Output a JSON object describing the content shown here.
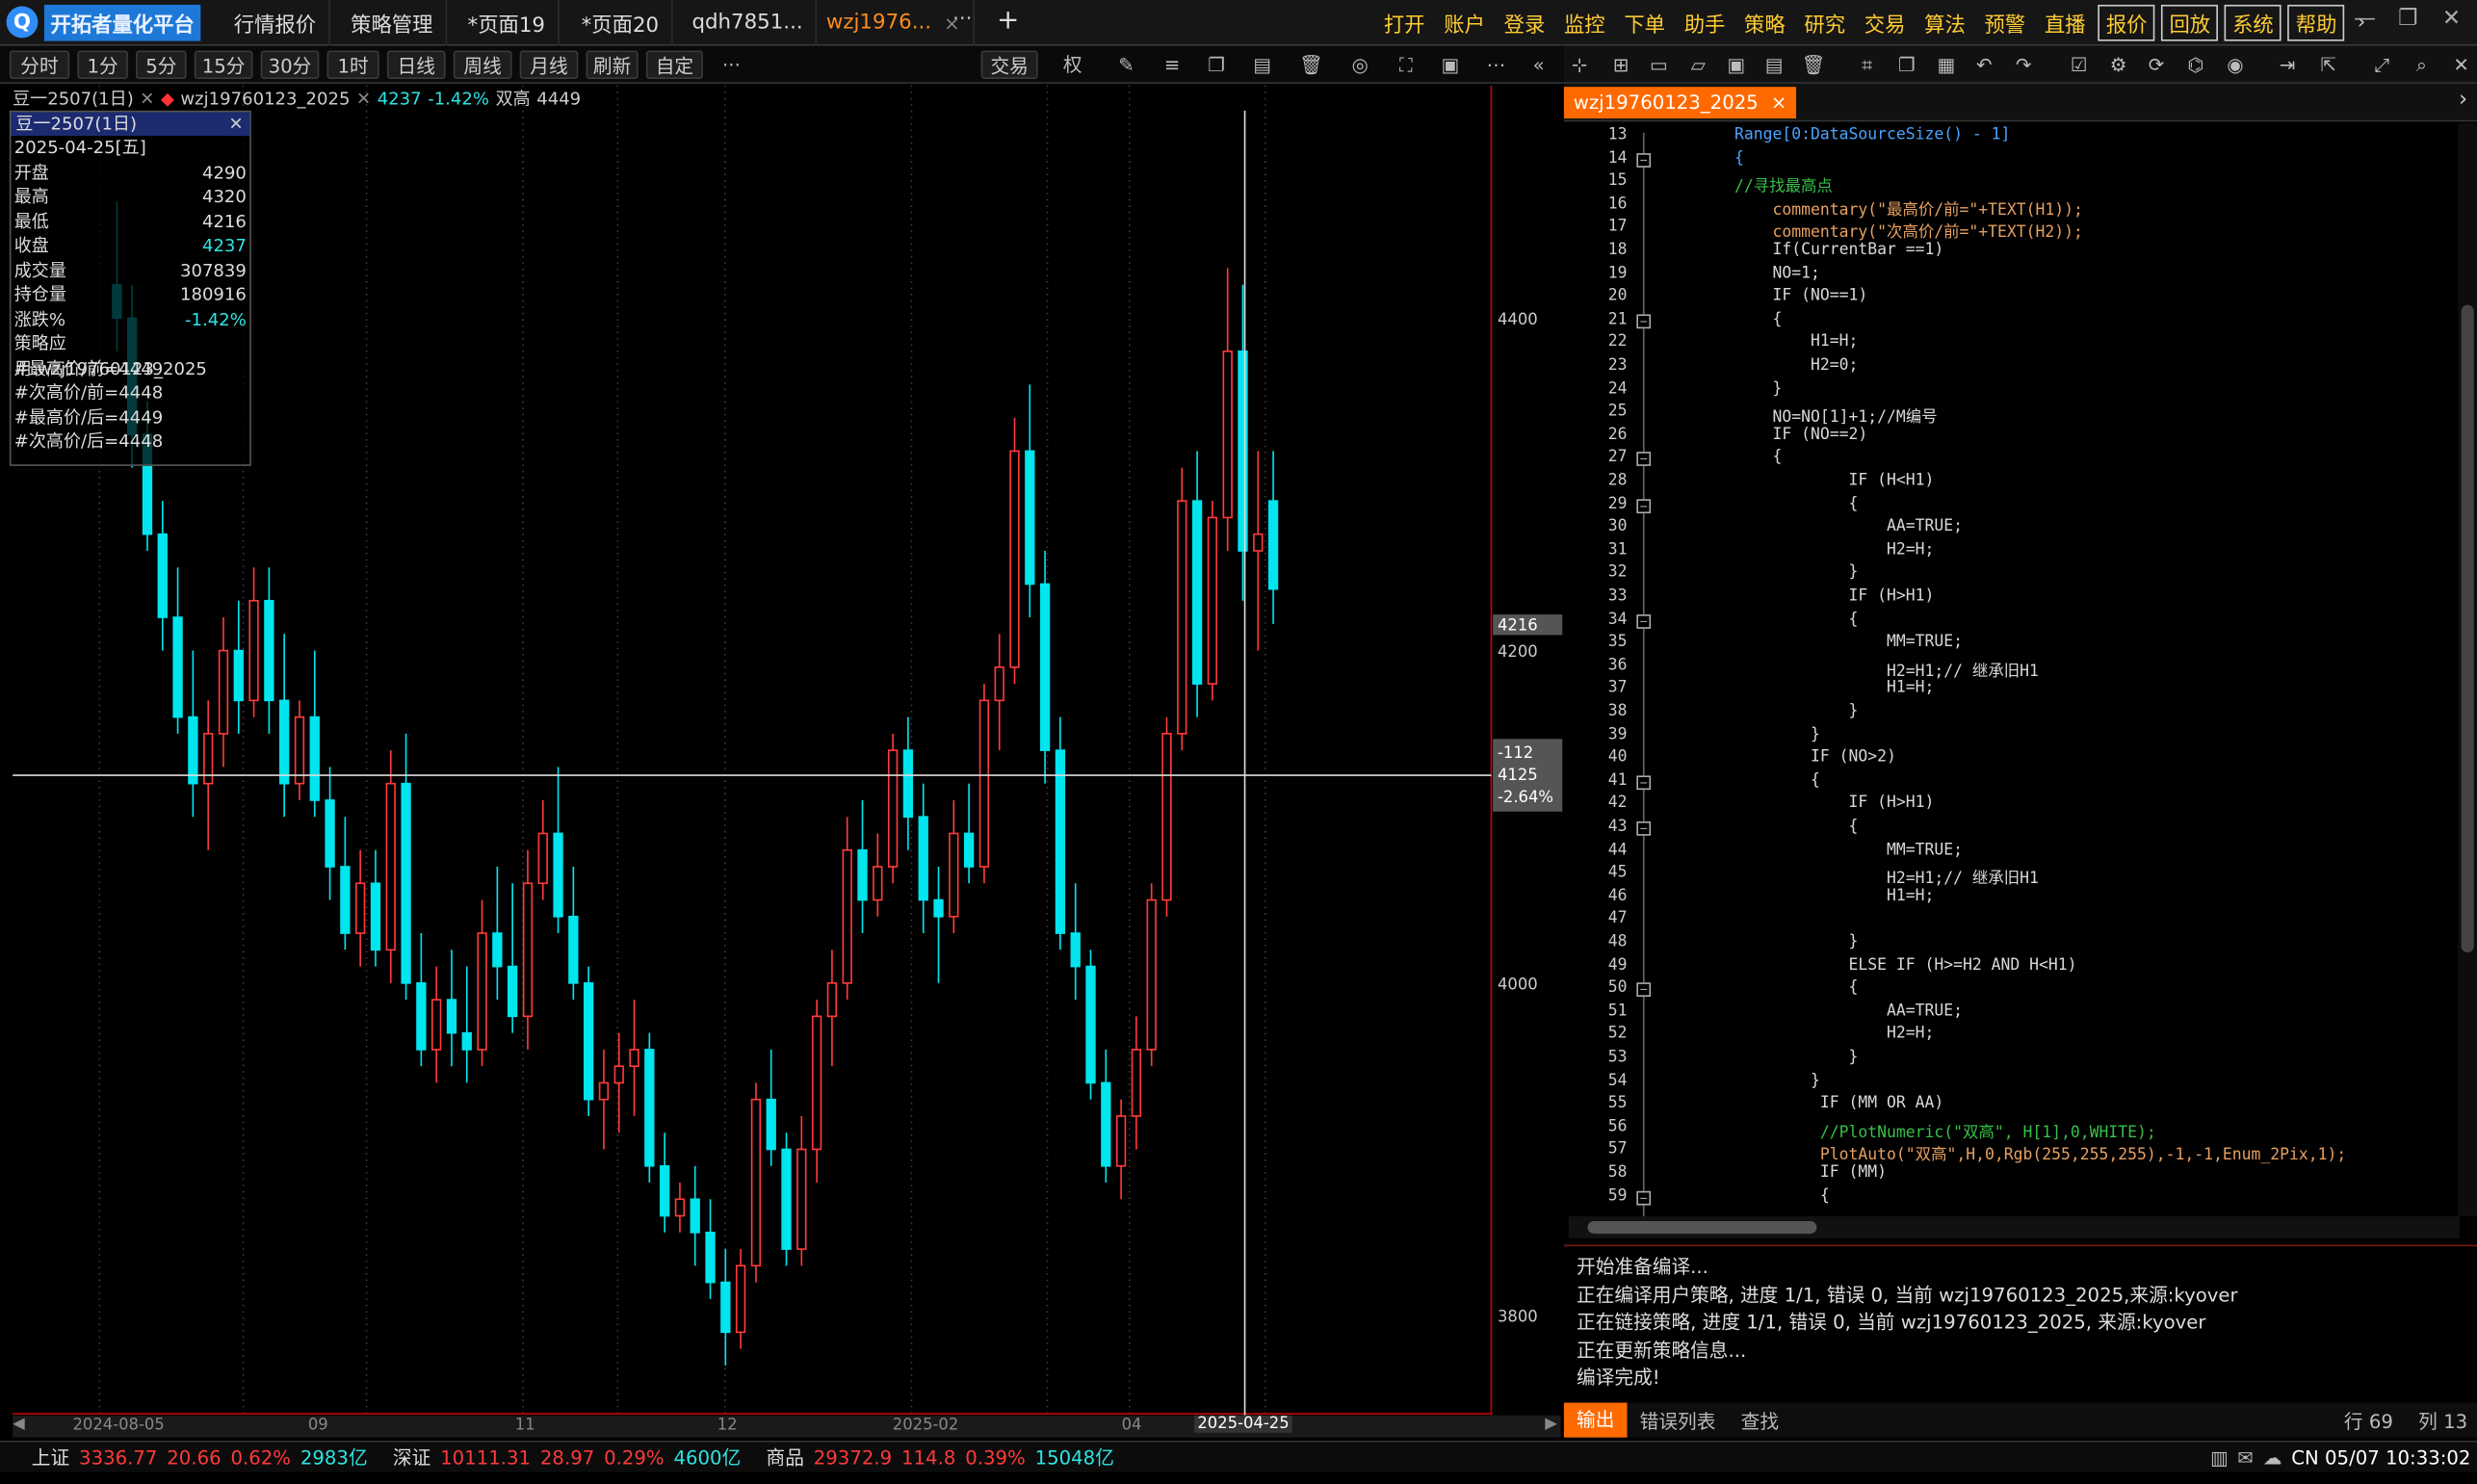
{
  "app": {
    "name": "开拓者量化平台"
  },
  "tabs": [
    {
      "label": "行情报价"
    },
    {
      "label": "策略管理"
    },
    {
      "label": "*页面19"
    },
    {
      "label": "*页面20"
    },
    {
      "label": "qdh7851..."
    },
    {
      "label": "wzj1976...",
      "close": "×"
    }
  ],
  "tab_more": "···",
  "tab_add": "+",
  "menu": [
    "打开",
    "账户",
    "登录",
    "监控",
    "下单",
    "助手",
    "策略",
    "研究",
    "交易",
    "算法",
    "预警",
    "直播"
  ],
  "menu_boxed": [
    "报价",
    "回放",
    "系统",
    "帮助"
  ],
  "periods": [
    "分时",
    "1分",
    "5分",
    "15分",
    "30分",
    "1时",
    "日线",
    "周线",
    "月线",
    "刷新",
    "自定"
  ],
  "period_more": "···",
  "trade_btn": "交易",
  "chart_tools": {
    "quan": "权"
  },
  "chart_info": {
    "symbol": "豆一2507(1日)",
    "strategy": "wzj19760123_2025",
    "price": "4237",
    "pct": "-1.42%",
    "label": "双高",
    "label_val": "4449"
  },
  "info_panel": {
    "title": "豆一2507(1日)",
    "date": "2025-04-25[五]",
    "rows": [
      [
        "开盘",
        "4290"
      ],
      [
        "最高",
        "4320"
      ],
      [
        "最低",
        "4216"
      ],
      [
        "收盘",
        "4237"
      ],
      [
        "成交量",
        "307839"
      ],
      [
        "持仓量",
        "180916"
      ],
      [
        "涨跌%",
        "-1.42%"
      ]
    ],
    "notes": [
      "策略应用:wzj19760123_2025",
      "#最高价/前=4449",
      "#次高价/前=4448",
      "#最高价/后=4449",
      "#次高价/后=4448"
    ]
  },
  "price_axis": {
    "ticks": [
      "4400",
      "4200",
      "4000",
      "3800"
    ],
    "last_price": "4216",
    "cross_diff": "-112",
    "cross_price": "4125",
    "cross_pct": "-2.64%"
  },
  "x_axis": {
    "labels": [
      "2024-08-05",
      "09",
      "11",
      "12",
      "2025-02",
      "04",
      "2025-04-25"
    ]
  },
  "status": {
    "items": [
      {
        "name": "上证",
        "val": "3336.77",
        "chg": "20.66",
        "pct": "0.62%",
        "amt": "2983亿"
      },
      {
        "name": "深证",
        "val": "10111.31",
        "chg": "28.97",
        "pct": "0.29%",
        "amt": "4600亿"
      },
      {
        "name": "商品",
        "val": "29372.9",
        "chg": "114.8",
        "pct": "0.39%",
        "amt": "15048亿"
      }
    ],
    "clock": "CN 05/07 10:33:02"
  },
  "editor": {
    "tab": "wzj19760123_2025",
    "close": "×",
    "cursor_row": "行 69",
    "cursor_col": "列 13",
    "lines": [
      {
        "n": "13",
        "t": "Range[0:DataSourceSize() - 1]",
        "i": 10,
        "c": "k"
      },
      {
        "n": "14",
        "t": "{",
        "i": 10,
        "c": "k"
      },
      {
        "n": "15",
        "t": "//寻找最高点",
        "i": 10,
        "c": "cm"
      },
      {
        "n": "16",
        "t": "commentary(\"最高价/前=\"+TEXT(H1));",
        "i": 14,
        "c": "s"
      },
      {
        "n": "17",
        "t": "commentary(\"次高价/前=\"+TEXT(H2));",
        "i": 14,
        "c": "s"
      },
      {
        "n": "18",
        "t": "If(CurrentBar ==1)",
        "i": 14,
        "c": "f"
      },
      {
        "n": "19",
        "t": "NO=1;",
        "i": 14,
        "c": "f"
      },
      {
        "n": "20",
        "t": "IF (NO==1)",
        "i": 14,
        "c": "f"
      },
      {
        "n": "21",
        "t": "{",
        "i": 14,
        "c": "f"
      },
      {
        "n": "22",
        "t": "H1=H;",
        "i": 18,
        "c": "f"
      },
      {
        "n": "23",
        "t": "H2=0;",
        "i": 18,
        "c": "f"
      },
      {
        "n": "24",
        "t": "}",
        "i": 14,
        "c": "f"
      },
      {
        "n": "25",
        "t": "NO=NO[1]+1;//M编号",
        "i": 14,
        "c": "f"
      },
      {
        "n": "26",
        "t": "IF (NO==2)",
        "i": 14,
        "c": "f"
      },
      {
        "n": "27",
        "t": "{",
        "i": 14,
        "c": "f"
      },
      {
        "n": "28",
        "t": "IF (H<H1)",
        "i": 22,
        "c": "f"
      },
      {
        "n": "29",
        "t": "{",
        "i": 22,
        "c": "f"
      },
      {
        "n": "30",
        "t": "AA=TRUE;",
        "i": 26,
        "c": "f"
      },
      {
        "n": "31",
        "t": "H2=H;",
        "i": 26,
        "c": "f"
      },
      {
        "n": "32",
        "t": "}",
        "i": 22,
        "c": "f"
      },
      {
        "n": "33",
        "t": "IF (H>H1)",
        "i": 22,
        "c": "f"
      },
      {
        "n": "34",
        "t": "{",
        "i": 22,
        "c": "f"
      },
      {
        "n": "35",
        "t": "MM=TRUE;",
        "i": 26,
        "c": "f"
      },
      {
        "n": "36",
        "t": "H2=H1;// 继承旧H1",
        "i": 26,
        "c": "f"
      },
      {
        "n": "37",
        "t": "H1=H;",
        "i": 26,
        "c": "f"
      },
      {
        "n": "38",
        "t": "}",
        "i": 22,
        "c": "f"
      },
      {
        "n": "39",
        "t": "}",
        "i": 18,
        "c": "f"
      },
      {
        "n": "40",
        "t": "IF (NO>2)",
        "i": 18,
        "c": "f"
      },
      {
        "n": "41",
        "t": "{",
        "i": 18,
        "c": "f"
      },
      {
        "n": "42",
        "t": "IF (H>H1)",
        "i": 22,
        "c": "f"
      },
      {
        "n": "43",
        "t": "{",
        "i": 22,
        "c": "f"
      },
      {
        "n": "44",
        "t": "MM=TRUE;",
        "i": 26,
        "c": "f"
      },
      {
        "n": "45",
        "t": "H2=H1;// 继承旧H1",
        "i": 26,
        "c": "f"
      },
      {
        "n": "46",
        "t": "H1=H;",
        "i": 26,
        "c": "f"
      },
      {
        "n": "47",
        "t": "",
        "i": 26,
        "c": "f"
      },
      {
        "n": "48",
        "t": "}",
        "i": 22,
        "c": "f"
      },
      {
        "n": "49",
        "t": "ELSE IF (H>=H2 AND H<H1)",
        "i": 22,
        "c": "f"
      },
      {
        "n": "50",
        "t": "{",
        "i": 22,
        "c": "f"
      },
      {
        "n": "51",
        "t": "AA=TRUE;",
        "i": 26,
        "c": "f"
      },
      {
        "n": "52",
        "t": "H2=H;",
        "i": 26,
        "c": "f"
      },
      {
        "n": "53",
        "t": "}",
        "i": 22,
        "c": "f"
      },
      {
        "n": "54",
        "t": "}",
        "i": 18,
        "c": "f"
      },
      {
        "n": "55",
        "t": "IF (MM OR AA)",
        "i": 19,
        "c": "f"
      },
      {
        "n": "56",
        "t": "//PlotNumeric(\"双高\", H[1],0,WHITE);",
        "i": 19,
        "c": "cm"
      },
      {
        "n": "57",
        "t": "PlotAuto(\"双高\",H,0,Rgb(255,255,255),-1,-1,Enum_2Pix,1);",
        "i": 19,
        "c": "s"
      },
      {
        "n": "58",
        "t": "IF (MM)",
        "i": 19,
        "c": "f"
      },
      {
        "n": "59",
        "t": "{",
        "i": 19,
        "c": "f"
      }
    ]
  },
  "output": {
    "lines": [
      "开始准备编译...",
      "正在编译用户策略, 进度 1/1, 错误 0, 当前 wzj19760123_2025,来源:kyover",
      "正在链接策略, 进度 1/1, 错误 0, 当前 wzj19760123_2025, 来源:kyover",
      "正在更新策略信息...",
      "编译完成!"
    ],
    "tabs": [
      "输出",
      "错误列表",
      "查找"
    ]
  },
  "chart_data": {
    "type": "candlestick",
    "y_range": [
      3740,
      4540
    ],
    "ticks": [
      4400,
      4200,
      4000,
      3800
    ],
    "crosshair_price": 4125,
    "colors": {
      "up": "#ff3a3a",
      "down": "#00e5ee",
      "grid": "#555",
      "axis": "#d00"
    },
    "candles": [
      [
        4420,
        4470,
        4380,
        4400
      ],
      [
        4400,
        4420,
        4310,
        4330
      ],
      [
        4330,
        4350,
        4260,
        4270
      ],
      [
        4270,
        4290,
        4200,
        4220
      ],
      [
        4220,
        4250,
        4150,
        4160
      ],
      [
        4160,
        4200,
        4100,
        4120
      ],
      [
        4120,
        4170,
        4080,
        4150
      ],
      [
        4150,
        4220,
        4130,
        4200
      ],
      [
        4200,
        4230,
        4150,
        4170
      ],
      [
        4170,
        4250,
        4160,
        4230
      ],
      [
        4230,
        4250,
        4150,
        4170
      ],
      [
        4170,
        4210,
        4100,
        4120
      ],
      [
        4120,
        4170,
        4110,
        4160
      ],
      [
        4160,
        4200,
        4100,
        4110
      ],
      [
        4110,
        4130,
        4050,
        4070
      ],
      [
        4070,
        4100,
        4020,
        4030
      ],
      [
        4030,
        4080,
        4010,
        4060
      ],
      [
        4060,
        4080,
        4010,
        4020
      ],
      [
        4020,
        4140,
        4000,
        4120
      ],
      [
        4120,
        4150,
        3990,
        4000
      ],
      [
        4000,
        4030,
        3950,
        3960
      ],
      [
        3960,
        4010,
        3940,
        3990
      ],
      [
        3990,
        4020,
        3950,
        3970
      ],
      [
        3970,
        4010,
        3940,
        3960
      ],
      [
        3960,
        4050,
        3950,
        4030
      ],
      [
        4030,
        4070,
        3990,
        4010
      ],
      [
        4010,
        4060,
        3970,
        3980
      ],
      [
        3980,
        4080,
        3960,
        4060
      ],
      [
        4060,
        4110,
        4050,
        4090
      ],
      [
        4090,
        4130,
        4030,
        4040
      ],
      [
        4040,
        4070,
        3990,
        4000
      ],
      [
        4000,
        4010,
        3920,
        3930
      ],
      [
        3930,
        3960,
        3900,
        3940
      ],
      [
        3940,
        3970,
        3910,
        3950
      ],
      [
        3950,
        3990,
        3920,
        3960
      ],
      [
        3960,
        3970,
        3880,
        3890
      ],
      [
        3890,
        3910,
        3850,
        3860
      ],
      [
        3860,
        3880,
        3850,
        3870
      ],
      [
        3870,
        3890,
        3830,
        3850
      ],
      [
        3850,
        3870,
        3810,
        3820
      ],
      [
        3820,
        3840,
        3770,
        3790
      ],
      [
        3790,
        3840,
        3780,
        3830
      ],
      [
        3830,
        3940,
        3820,
        3930
      ],
      [
        3930,
        3960,
        3890,
        3900
      ],
      [
        3900,
        3910,
        3830,
        3840
      ],
      [
        3840,
        3920,
        3830,
        3900
      ],
      [
        3900,
        3990,
        3880,
        3980
      ],
      [
        3980,
        4020,
        3950,
        4000
      ],
      [
        4000,
        4100,
        3990,
        4080
      ],
      [
        4080,
        4110,
        4030,
        4050
      ],
      [
        4050,
        4090,
        4040,
        4070
      ],
      [
        4070,
        4150,
        4060,
        4140
      ],
      [
        4140,
        4160,
        4080,
        4100
      ],
      [
        4100,
        4120,
        4030,
        4050
      ],
      [
        4050,
        4070,
        4000,
        4040
      ],
      [
        4040,
        4110,
        4030,
        4090
      ],
      [
        4090,
        4120,
        4060,
        4070
      ],
      [
        4070,
        4180,
        4060,
        4170
      ],
      [
        4170,
        4210,
        4140,
        4190
      ],
      [
        4190,
        4340,
        4180,
        4320
      ],
      [
        4320,
        4360,
        4220,
        4240
      ],
      [
        4240,
        4260,
        4120,
        4140
      ],
      [
        4140,
        4160,
        4020,
        4030
      ],
      [
        4030,
        4060,
        3990,
        4010
      ],
      [
        4010,
        4020,
        3930,
        3940
      ],
      [
        3940,
        3960,
        3880,
        3890
      ],
      [
        3890,
        3930,
        3870,
        3920
      ],
      [
        3920,
        3980,
        3900,
        3960
      ],
      [
        3960,
        4060,
        3950,
        4050
      ],
      [
        4050,
        4160,
        4040,
        4150
      ],
      [
        4150,
        4310,
        4140,
        4290
      ],
      [
        4290,
        4320,
        4160,
        4180
      ],
      [
        4180,
        4290,
        4170,
        4280
      ],
      [
        4280,
        4430,
        4260,
        4380
      ],
      [
        4380,
        4420,
        4230,
        4260
      ],
      [
        4260,
        4320,
        4200,
        4270
      ],
      [
        4290,
        4320,
        4216,
        4237
      ]
    ]
  }
}
